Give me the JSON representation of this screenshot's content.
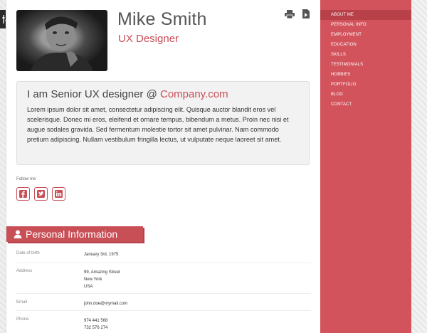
{
  "profile": {
    "name": "Mike Smith",
    "role": "UX Designer"
  },
  "intro": {
    "title_prefix": "I am Senior UX designer @ ",
    "title_company": "Company.com",
    "body": "Lorem ipsum dolor sit amet, consectetur adipiscing elit. Quisque auctor blandit eros vel scelerisque. Donec mi eros, eleifend et ornare tempus, bibendum a metus. Proin nec nisi et augue sodales gravida. Sed fermentum molestie tortor sit amet pulvinar. Nam commodo pretium adipiscing. Nullam vestibulum fringilla lectus, ut vulputate neque laoreet sit amet."
  },
  "social": {
    "label": "Follow me",
    "icons": [
      "facebook-icon",
      "twitter-icon",
      "linkedin-icon"
    ]
  },
  "personal": {
    "title": "Personal Information",
    "rows": [
      {
        "label": "Date of birth",
        "value": "January 3rd, 1975"
      },
      {
        "label": "Address",
        "value": "99, Amazing Street\nNew York\nUSA"
      },
      {
        "label": "Email",
        "value": "john.doe@mymail.com"
      },
      {
        "label": "Phone",
        "value": "974 441 568\n732 576 274"
      }
    ]
  },
  "nav": {
    "items": [
      "ABOUT ME",
      "PERSONAL INFO",
      "EMPLOYMENT",
      "EDUCATION",
      "SKILLS",
      "TESTIMONIALS",
      "HOBBIES",
      "PORTFOLIO",
      "BLOG",
      "CONTACT"
    ],
    "active": "ABOUT ME"
  },
  "colors": {
    "accent": "#c94f57",
    "nav_bg": "#d2535b",
    "nav_active": "#b84149"
  }
}
